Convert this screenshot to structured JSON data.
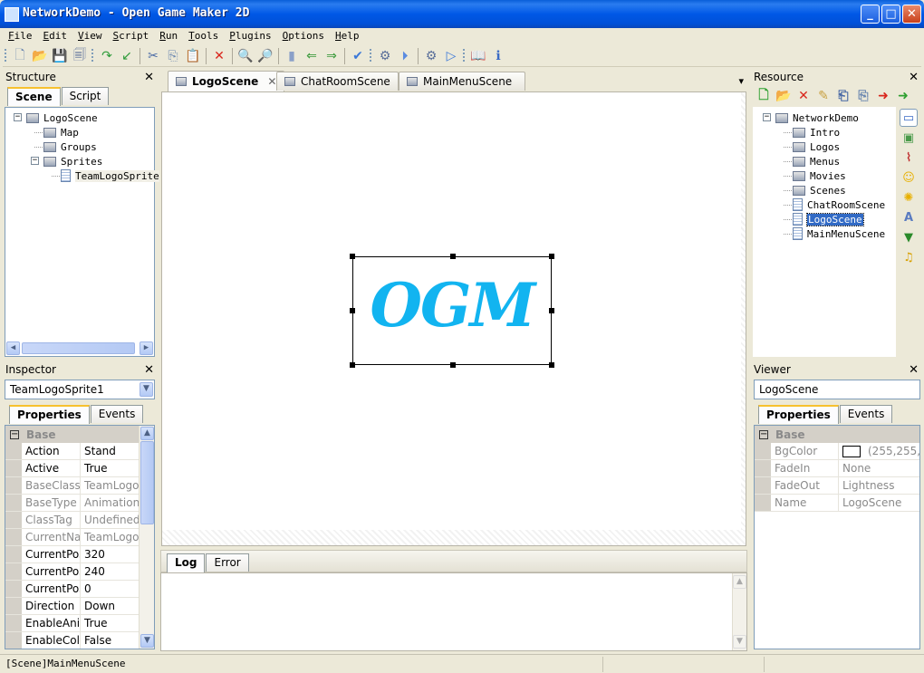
{
  "window": {
    "title": "NetworkDemo - Open Game Maker 2D",
    "controls": {
      "minimize": "_",
      "maximize": "□",
      "close": "✕"
    }
  },
  "menu": [
    {
      "label": "File",
      "u": "F",
      "rest": "ile"
    },
    {
      "label": "Edit",
      "u": "E",
      "rest": "dit"
    },
    {
      "label": "View",
      "u": "V",
      "rest": "iew"
    },
    {
      "label": "Script",
      "u": "S",
      "rest": "cript"
    },
    {
      "label": "Run",
      "u": "R",
      "rest": "un"
    },
    {
      "label": "Tools",
      "u": "T",
      "rest": "ools"
    },
    {
      "label": "Plugins",
      "u": "P",
      "rest": "lugins"
    },
    {
      "label": "Options",
      "u": "O",
      "rest": "ptions"
    },
    {
      "label": "Help",
      "u": "H",
      "rest": "elp"
    }
  ],
  "toolbar": [
    {
      "name": "new-file",
      "glyph": "🗋",
      "color": "#6b87b0"
    },
    {
      "name": "open-folder",
      "glyph": "📂",
      "color": "#e0a820"
    },
    {
      "name": "save",
      "glyph": "💾",
      "color": "#3b6bc5"
    },
    {
      "name": "save-all",
      "glyph": "🗐",
      "color": "#5a6f9a"
    },
    {
      "name": "redo",
      "glyph": "↷",
      "color": "#2e9b3a"
    },
    {
      "name": "undo",
      "glyph": "↙",
      "color": "#2e9b3a"
    },
    {
      "name": "cut",
      "glyph": "✂",
      "color": "#4a6aa5"
    },
    {
      "name": "copy",
      "glyph": "⎘",
      "color": "#6b87b0"
    },
    {
      "name": "paste",
      "glyph": "📋",
      "color": "#c8a040"
    },
    {
      "name": "delete",
      "glyph": "✕",
      "color": "#d9261c"
    },
    {
      "name": "find",
      "glyph": "🔍",
      "color": "#4a6aa5"
    },
    {
      "name": "replace",
      "glyph": "🔎",
      "color": "#3a8a3a"
    },
    {
      "name": "bookmark",
      "glyph": "▮",
      "color": "#8aa0c8"
    },
    {
      "name": "prev-bookmark",
      "glyph": "⇐",
      "color": "#3a9a3a"
    },
    {
      "name": "next-bookmark",
      "glyph": "⇒",
      "color": "#3a9a3a"
    },
    {
      "name": "spell-check",
      "glyph": "✔",
      "color": "#3b78d8"
    },
    {
      "name": "build",
      "glyph": "⚙",
      "color": "#5a6f9a"
    },
    {
      "name": "run-debug",
      "glyph": "⏵",
      "color": "#5b8be0"
    },
    {
      "name": "build-all",
      "glyph": "⚙",
      "color": "#5a6f9a"
    },
    {
      "name": "run",
      "glyph": "▷",
      "color": "#3b78d8"
    },
    {
      "name": "help-book",
      "glyph": "📖",
      "color": "#3b78d8"
    },
    {
      "name": "about",
      "glyph": "ℹ",
      "color": "#3b6bc5"
    }
  ],
  "structure": {
    "title": "Structure",
    "tabs": [
      "Scene",
      "Script"
    ],
    "tree": [
      {
        "label": "LogoScene",
        "type": "folder",
        "level": 0,
        "expander": "−"
      },
      {
        "label": "Map",
        "type": "folder",
        "level": 1
      },
      {
        "label": "Groups",
        "type": "folder",
        "level": 1
      },
      {
        "label": "Sprites",
        "type": "folder",
        "level": 1,
        "expander": "−"
      },
      {
        "label": "TeamLogoSprite",
        "type": "doc",
        "level": 2
      }
    ]
  },
  "inspector": {
    "title": "Inspector",
    "selected_object": "TeamLogoSprite1",
    "tabs": [
      "Properties",
      "Events"
    ],
    "category": "Base",
    "properties": [
      {
        "key": "Action",
        "value": "Stand",
        "dim": false
      },
      {
        "key": "Active",
        "value": "True",
        "dim": false
      },
      {
        "key": "BaseClass",
        "value": "TeamLogo",
        "dim": true
      },
      {
        "key": "BaseType",
        "value": "Animation",
        "dim": true
      },
      {
        "key": "ClassTag",
        "value": "Undefined",
        "dim": true
      },
      {
        "key": "CurrentNar",
        "value": "TeamLogo",
        "dim": true
      },
      {
        "key": "CurrentPos",
        "value": "320",
        "dim": false
      },
      {
        "key": "CurrentPos",
        "value": "240",
        "dim": false
      },
      {
        "key": "CurrentPos",
        "value": "0",
        "dim": false
      },
      {
        "key": "Direction",
        "value": "Down",
        "dim": false
      },
      {
        "key": "EnableAnin",
        "value": "True",
        "dim": false
      },
      {
        "key": "EnableCollis",
        "value": "False",
        "dim": false
      }
    ]
  },
  "editor": {
    "tabs": [
      {
        "label": "LogoScene",
        "active": true,
        "closable": true
      },
      {
        "label": "ChatRoomScene",
        "active": false
      },
      {
        "label": "MainMenuScene",
        "active": false
      }
    ],
    "tab_menu": "▾",
    "sprite_text": "OGM",
    "sprite_color": "#12b4f0"
  },
  "log": {
    "tabs": [
      "Log",
      "Error"
    ]
  },
  "resource": {
    "title": "Resource",
    "toolbar": [
      {
        "name": "add-resource",
        "glyph": "🗋",
        "color": "#2ea030"
      },
      {
        "name": "add-folder",
        "glyph": "📂",
        "color": "#e0a820"
      },
      {
        "name": "remove-resource",
        "glyph": "✕",
        "color": "#d9261c"
      },
      {
        "name": "rename-resource",
        "glyph": "✎",
        "color": "#c8a040"
      },
      {
        "name": "properties-resource",
        "glyph": "⎗",
        "color": "#4a6aa5"
      },
      {
        "name": "copy-resource",
        "glyph": "⎘",
        "color": "#6b87b0"
      },
      {
        "name": "import-resource",
        "glyph": "➜",
        "color": "#d9261c"
      },
      {
        "name": "export-resource",
        "glyph": "➜",
        "color": "#2ea030"
      }
    ],
    "tree": [
      {
        "label": "NetworkDemo",
        "type": "folder",
        "level": 0,
        "expander": "−"
      },
      {
        "label": "Intro",
        "type": "folder",
        "level": 1
      },
      {
        "label": "Logos",
        "type": "folder",
        "level": 1
      },
      {
        "label": "Menus",
        "type": "folder",
        "level": 1
      },
      {
        "label": "Movies",
        "type": "folder",
        "level": 1
      },
      {
        "label": "Scenes",
        "type": "folder",
        "level": 1
      },
      {
        "label": "ChatRoomScene",
        "type": "doc",
        "level": 1
      },
      {
        "label": "LogoScene",
        "type": "doc",
        "level": 1,
        "selected": true
      },
      {
        "label": "MainMenuScene",
        "type": "doc",
        "level": 1
      }
    ],
    "side_filters": [
      {
        "name": "scene-filter",
        "glyph": "▭",
        "color": "#3b6bc5"
      },
      {
        "name": "image-filter",
        "glyph": "▣",
        "color": "#4a9a4a"
      },
      {
        "name": "animation-filter",
        "glyph": "⌇",
        "color": "#c03030"
      },
      {
        "name": "sprite-filter",
        "glyph": "☺",
        "color": "#e8b000"
      },
      {
        "name": "particle-filter",
        "glyph": "✺",
        "color": "#e8b000"
      },
      {
        "name": "font-filter",
        "glyph": "A",
        "color": "#5a7bc0"
      },
      {
        "name": "tilemap-filter",
        "glyph": "▼",
        "color": "#2a8a2a"
      },
      {
        "name": "sound-filter",
        "glyph": "♫",
        "color": "#d8a000"
      }
    ]
  },
  "viewer": {
    "title": "Viewer",
    "selected_object": "LogoScene",
    "tabs": [
      "Properties",
      "Events"
    ],
    "category": "Base",
    "properties": [
      {
        "key": "BgColor",
        "value": "(255,255,",
        "swatch": "#ffffff"
      },
      {
        "key": "FadeIn",
        "value": "None"
      },
      {
        "key": "FadeOut",
        "value": "Lightness"
      },
      {
        "key": "Name",
        "value": "LogoScene"
      }
    ]
  },
  "status": {
    "text": "[Scene]MainMenuScene"
  }
}
